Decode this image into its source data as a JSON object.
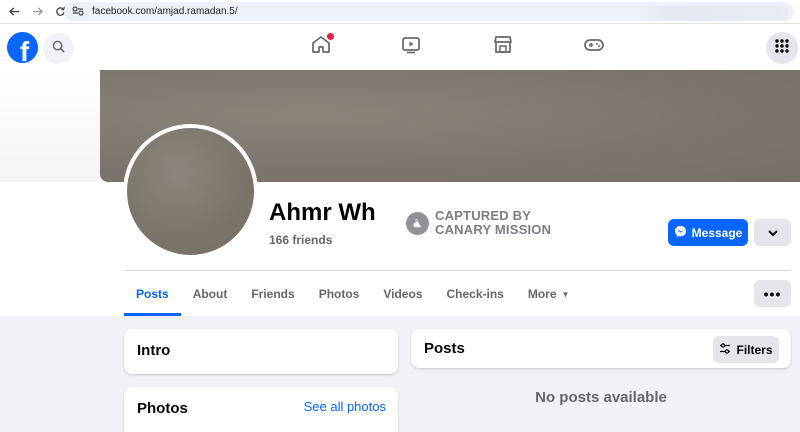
{
  "browser": {
    "url": "facebook.com/amjad.ramadan.5/"
  },
  "header": {
    "logo_letter": "f",
    "nav_icons": [
      "home-icon",
      "video-icon",
      "marketplace-icon",
      "gaming-icon"
    ],
    "accent_color": "#0866ff"
  },
  "profile": {
    "name": "Ahmr Wh",
    "friends": "166 friends",
    "badge_line1": "CAPTURED BY",
    "badge_line2": "CANARY MISSION",
    "message_label": "Message"
  },
  "tabs": [
    {
      "label": "Posts",
      "active": true
    },
    {
      "label": "About"
    },
    {
      "label": "Friends"
    },
    {
      "label": "Photos"
    },
    {
      "label": "Videos"
    },
    {
      "label": "Check-ins"
    },
    {
      "label": "More"
    }
  ],
  "more_dots": "•••",
  "intro": {
    "title": "Intro"
  },
  "photos": {
    "title": "Photos",
    "see_all": "See all photos"
  },
  "posts": {
    "title": "Posts",
    "filters_label": "Filters",
    "empty_text": "No posts available"
  }
}
